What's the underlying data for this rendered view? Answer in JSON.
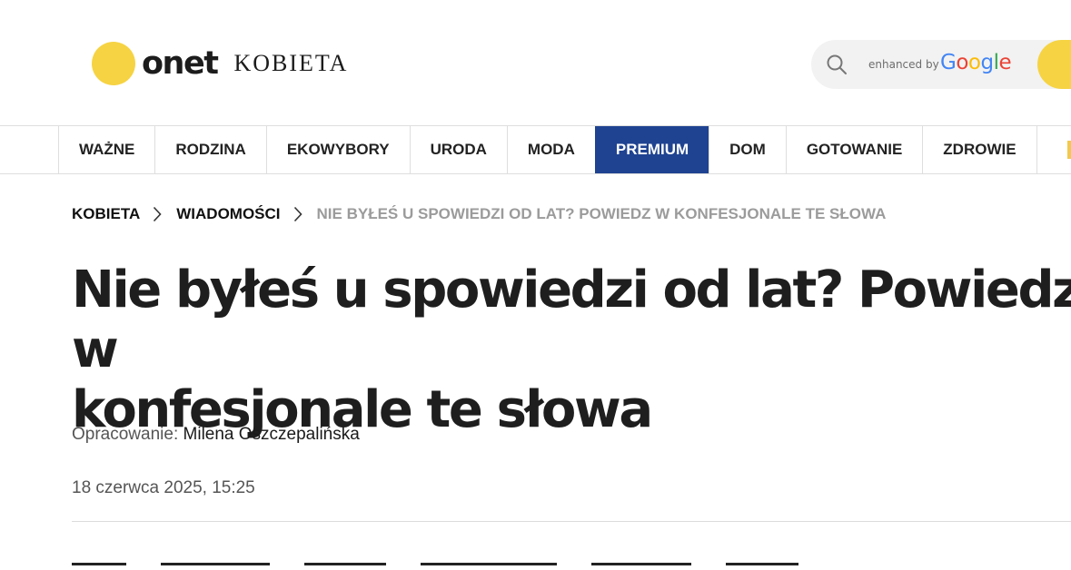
{
  "header": {
    "logo_brand": "onet",
    "logo_section": "KOBIETA",
    "search": {
      "enhanced_by": "enhanced by",
      "google_letters": [
        {
          "char": "G",
          "color": "#4285F4"
        },
        {
          "char": "o",
          "color": "#EA4335"
        },
        {
          "char": "o",
          "color": "#FBBC05"
        },
        {
          "char": "g",
          "color": "#4285F4"
        },
        {
          "char": "l",
          "color": "#34A853"
        },
        {
          "char": "e",
          "color": "#EA4335"
        }
      ]
    }
  },
  "nav": {
    "items": [
      {
        "label": "WAŻNE"
      },
      {
        "label": "RODZINA"
      },
      {
        "label": "EKOWYBORY"
      },
      {
        "label": "URODA"
      },
      {
        "label": "MODA"
      },
      {
        "label": "PREMIUM",
        "highlighted": true
      },
      {
        "label": "DOM"
      },
      {
        "label": "GOTOWANIE"
      },
      {
        "label": "ZDROWIE"
      }
    ]
  },
  "breadcrumb": {
    "items": [
      {
        "label": "KOBIETA"
      },
      {
        "label": "WIADOMOŚCI"
      },
      {
        "label": "NIE BYŁEŚ U SPOWIEDZI OD LAT? POWIEDZ W KONFESJONALE TE SŁOWA",
        "current": true
      }
    ]
  },
  "article": {
    "title_line1": "Nie byłeś u spowiedzi od lat? Powiedz w",
    "title_line2": "konfesjonale te słowa",
    "author_label": "Opracowanie:",
    "author_name": "Milena Oszczepalińska",
    "date": "18 czerwca 2025, 15:25"
  },
  "colors": {
    "brand_yellow": "#f6d343",
    "premium_blue": "#1f4391",
    "breadcrumb_current": "#9b9b9b"
  }
}
